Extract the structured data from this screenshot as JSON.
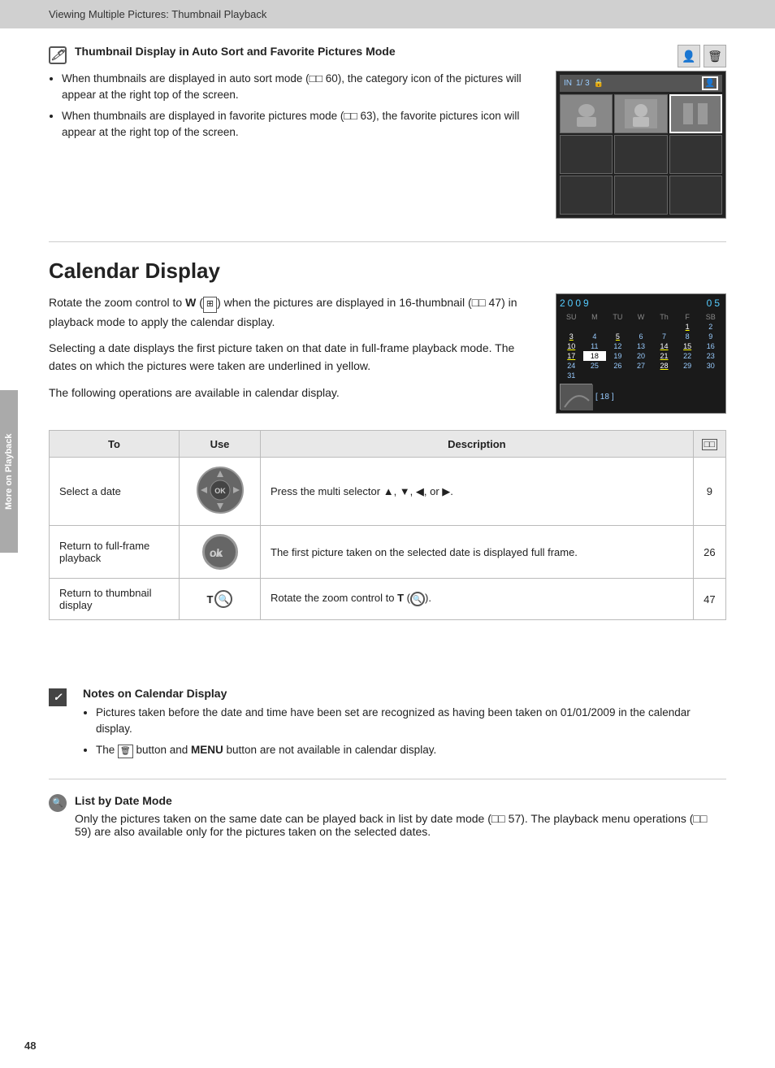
{
  "header": {
    "title": "Viewing Multiple Pictures: Thumbnail Playback"
  },
  "sidebar": {
    "label": "More on Playback"
  },
  "thumbnail_section": {
    "icon": "🖊",
    "title": "Thumbnail Display in Auto Sort and Favorite Pictures Mode",
    "bullets": [
      "When thumbnails are displayed in auto sort mode (□□ 60), the category icon of the pictures will appear at the right top of the screen.",
      "When thumbnails are displayed in favorite pictures mode (□□ 63), the favorite pictures icon will appear at the right top of the screen."
    ]
  },
  "calendar_section": {
    "title": "Calendar Display",
    "paragraphs": [
      "Rotate the zoom control to W (□□) when the pictures are displayed in 16-thumbnail (□□ 47) in playback mode to apply the calendar display.",
      "Selecting a date displays the first picture taken on that date in full-frame playback mode. The dates on which the pictures were taken are underlined in yellow.",
      "The following operations are available in calendar display."
    ]
  },
  "table": {
    "headers": [
      "To",
      "Use",
      "Description",
      "📖"
    ],
    "rows": [
      {
        "to": "Select a date",
        "use": "multi-selector",
        "description": "Press the multi selector ▲, ▼, ◀, or ▶.",
        "ref": "9"
      },
      {
        "to": "Return to full-frame playback",
        "use": "ok-btn",
        "description": "The first picture taken on the selected date is displayed full frame.",
        "ref": "26"
      },
      {
        "to": "Return to thumbnail display",
        "use": "t-zoom",
        "description": "Rotate the zoom control to T (🔍).",
        "ref": "47"
      }
    ]
  },
  "notes_section": {
    "icon": "✓",
    "title": "Notes on Calendar Display",
    "bullets": [
      "Pictures taken before the date and time have been set are recognized as having been taken on 01/01/2009 in the calendar display.",
      "The 🗑 button and MENU button are not available in calendar display."
    ]
  },
  "list_by_date": {
    "icon": "🔍",
    "title": "List by Date Mode",
    "text": "Only the pictures taken on the same date can be played back in list by date mode (□□ 57). The playback menu operations (□□ 59) are also available only for the pictures taken on the selected dates."
  },
  "page_number": "48",
  "calendar_display": {
    "year": "2009",
    "month": "05",
    "days_header": [
      "SU",
      "M",
      "TU",
      "W",
      "Th",
      "F",
      "SB"
    ],
    "weeks": [
      [
        "",
        "",
        "",
        "",
        "",
        "1",
        "2"
      ],
      [
        "3",
        "4",
        "5",
        "6",
        "7",
        "8",
        "9"
      ],
      [
        "10",
        "11",
        "12",
        "13",
        "14",
        "15",
        "16"
      ],
      [
        "17",
        "18",
        "19",
        "20",
        "21",
        "22",
        "23"
      ],
      [
        "24",
        "25",
        "26",
        "27",
        "28",
        "29",
        "30"
      ],
      [
        "31",
        "",
        "",
        "",
        "",
        "",
        ""
      ]
    ],
    "underlined_days": [
      "3",
      "5",
      "10",
      "14",
      "17",
      "21",
      "28"
    ],
    "selected_date": "18",
    "frame_count": "18"
  }
}
